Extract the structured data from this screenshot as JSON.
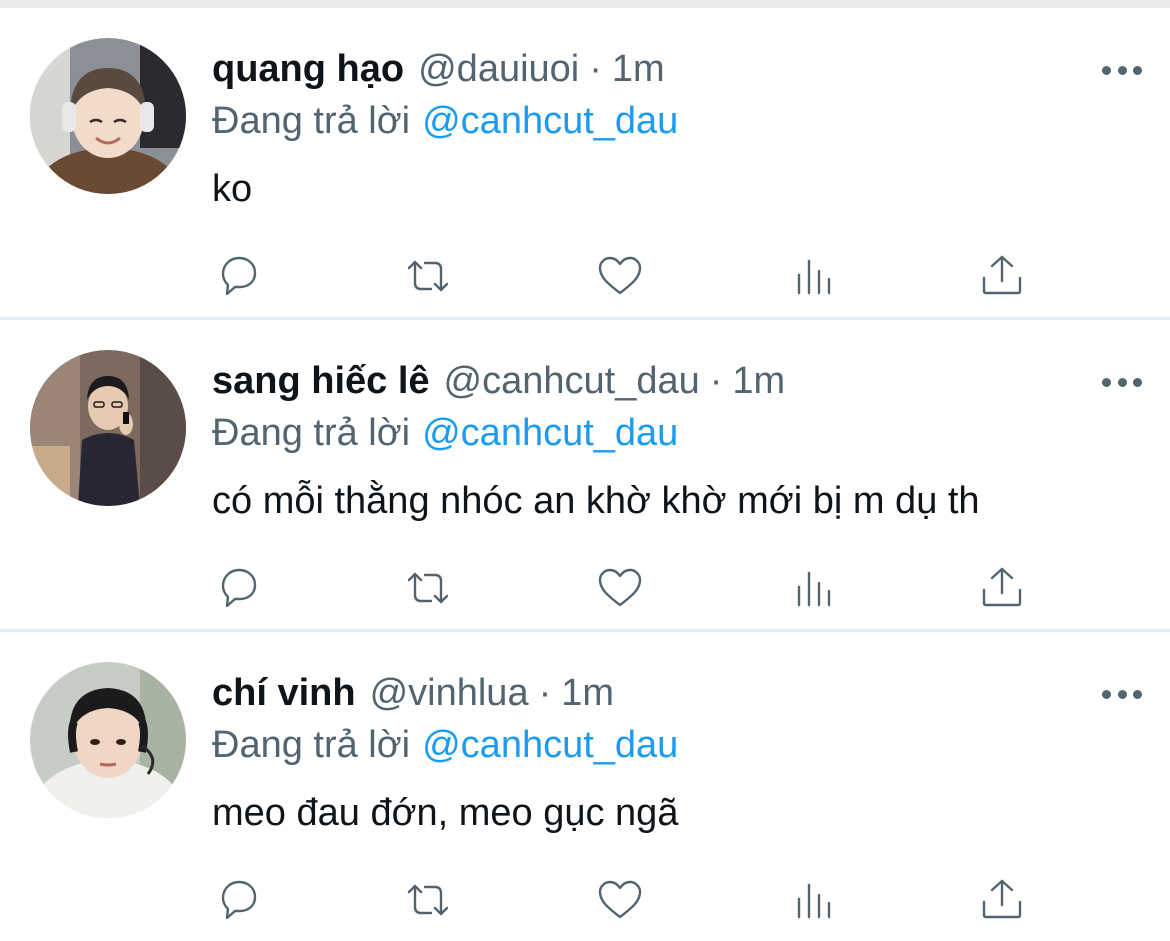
{
  "tweets": [
    {
      "name": "quang hạo",
      "handle": "@dauiuoi",
      "separator": "·",
      "time": "1m",
      "reply_prefix": "Đang trả lời",
      "reply_to": "@canhcut_dau",
      "text": "ko",
      "avatar_colors": {
        "bg": "#8c8f96",
        "hair": "#5a4a3e",
        "skin": "#f1dccb",
        "shirt": "#6b4a34"
      }
    },
    {
      "name": "sang hiếc lê",
      "handle": "@canhcut_dau",
      "separator": "·",
      "time": "1m",
      "reply_prefix": "Đang trả lời",
      "reply_to": "@canhcut_dau",
      "text": "có mỗi thằng nhóc an khờ khờ mới bị m dụ th",
      "avatar_colors": {
        "bg": "#7d6a5e",
        "hair": "#1c1a1c",
        "skin": "#e6c9b1",
        "shirt": "#262733"
      }
    },
    {
      "name": "chí vinh",
      "handle": "@vinhlua",
      "separator": "·",
      "time": "1m",
      "reply_prefix": "Đang trả lời",
      "reply_to": "@canhcut_dau",
      "text": "meo đau đớn, meo gục ngã",
      "avatar_colors": {
        "bg": "#c8ccc6",
        "hair": "#1b1b1e",
        "skin": "#f0d6c5",
        "shirt": "#f2f0ec"
      }
    }
  ],
  "actions": [
    {
      "icon": "reply-icon"
    },
    {
      "icon": "retweet-icon"
    },
    {
      "icon": "like-icon"
    },
    {
      "icon": "analytics-icon"
    },
    {
      "icon": "share-icon"
    }
  ],
  "colors": {
    "text_primary": "#0f1419",
    "text_secondary": "#536471",
    "accent": "#1d9bf0",
    "divider": "#e6ecf0"
  }
}
